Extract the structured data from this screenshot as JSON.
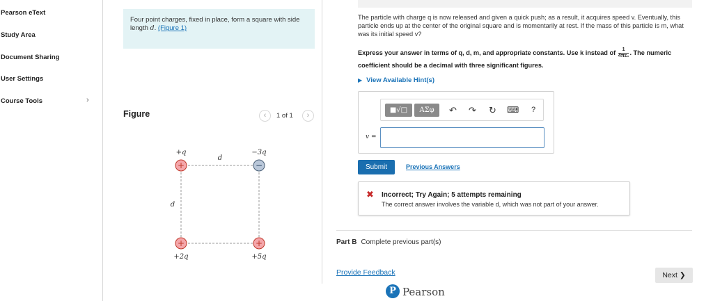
{
  "sidebar": {
    "items": [
      {
        "label": "Pearson eText"
      },
      {
        "label": "Study Area"
      },
      {
        "label": "Document Sharing"
      },
      {
        "label": "User Settings"
      },
      {
        "label": "Course Tools"
      }
    ]
  },
  "problem": {
    "intro": "Four point charges, fixed in place, form a square with side length ",
    "var": "d",
    "figure_link": "(Figure 1)"
  },
  "figure": {
    "title": "Figure",
    "pager": "1 of 1",
    "labels": {
      "top_left": "+q",
      "top_right": "−3q",
      "bottom_left": "+2q",
      "bottom_right": "+5q",
      "top_side": "d",
      "left_side": "d"
    }
  },
  "question": {
    "text": "The particle with charge q is now released and given a quick push; as a result, it acquires speed v. Eventually, this particle ends up at the center of the original square and is momentarily at rest. If the mass of this particle is m, what was its initial speed v?",
    "instruction_before": "Express your answer in terms of q, d, m, and appropriate constants. Use k instead of",
    "fraction_num": "1",
    "fraction_den": "4πε₀",
    "instruction_after": ". The numeric coefficient should be a decimal with three significant figures.",
    "hint_label": "View Available Hint(s)"
  },
  "answer": {
    "var_label": "v =",
    "value": "",
    "toolbar": {
      "templates": "■√□",
      "greek": "ΑΣφ",
      "help": "?"
    }
  },
  "actions": {
    "submit": "Submit",
    "previous_answers": "Previous Answers"
  },
  "feedback": {
    "title": "Incorrect; Try Again; 5 attempts remaining",
    "message": "The correct answer involves the variable d, which was not part of your answer."
  },
  "part_b": {
    "label": "Part B",
    "text": "Complete previous part(s)"
  },
  "footer": {
    "provide_feedback": "Provide Feedback",
    "next": "Next ❯",
    "brand": "Pearson"
  },
  "colors": {
    "accent": "#1a73b8",
    "submit": "#1a6eaf",
    "problem_bg": "#e3f3f5",
    "positive_charge": "#f4a6aa",
    "negative_charge": "#b9c7d9",
    "error": "#c62828"
  }
}
